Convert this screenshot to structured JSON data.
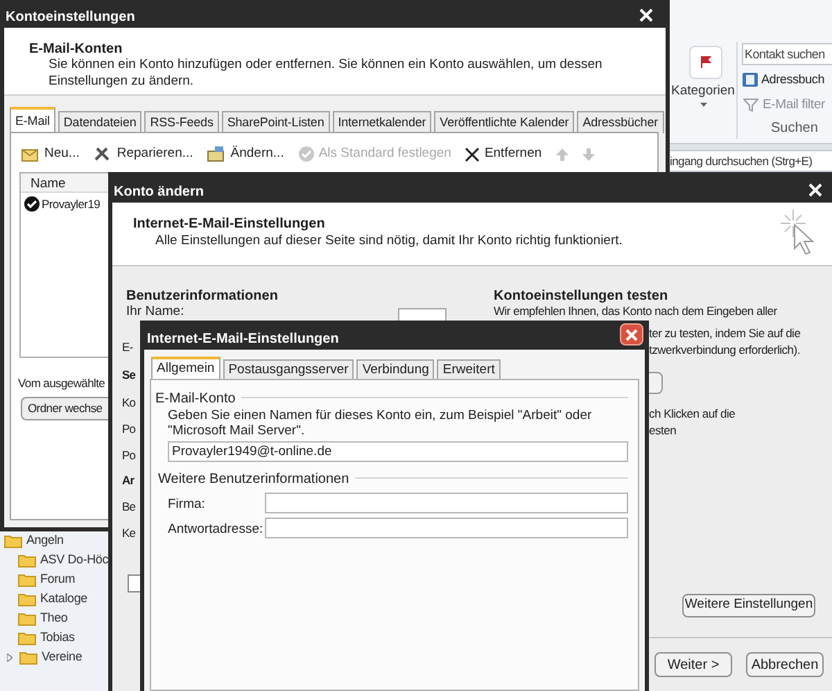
{
  "outlook": {
    "ribbon": {
      "categories_label": "Kategorien",
      "contact_search": {
        "placeholder": "Kontakt suchen"
      },
      "address_book": "Adressbuch",
      "filter_email": {
        "label": "E-Mail filter",
        "disabled": true
      },
      "group_label": "Suchen"
    },
    "search": {
      "placeholder": "ingang durchsuchen (Strg+E)"
    },
    "folders": [
      {
        "name": "Angeln",
        "kind": "folder",
        "children": [
          {
            "name": "ASV Do-Höc",
            "kind": "folder"
          },
          {
            "name": "Forum",
            "kind": "folder"
          },
          {
            "name": "Kataloge",
            "kind": "folder"
          },
          {
            "name": "Theo",
            "kind": "folder"
          },
          {
            "name": "Tobias",
            "kind": "folder"
          },
          {
            "name": "Vereine",
            "kind": "collapsed-folder"
          }
        ]
      }
    ]
  },
  "account_settings": {
    "title": "Kontoeinstellungen",
    "heading": "E-Mail-Konten",
    "description": "Sie können ein Konto hinzufügen oder entfernen. Sie können ein Konto auswählen, um dessen Einstellungen zu ändern.",
    "tabs": [
      {
        "label": "E-Mail",
        "selected": true
      },
      {
        "label": "Datendateien",
        "selected": false
      },
      {
        "label": "RSS-Feeds",
        "selected": false
      },
      {
        "label": "SharePoint-Listen",
        "selected": false
      },
      {
        "label": "Internetkalender",
        "selected": false
      },
      {
        "label": "Veröffentlichte Kalender",
        "selected": false
      },
      {
        "label": "Adressbücher",
        "selected": false
      }
    ],
    "toolbar": [
      {
        "kind": "button",
        "label": "Neu...",
        "disabled": false
      },
      {
        "kind": "button",
        "label": "Reparieren...",
        "disabled": false
      },
      {
        "kind": "button",
        "label": "Ändern...",
        "disabled": false
      },
      {
        "kind": "button",
        "label": "Als Standard festlegen",
        "disabled": true
      },
      {
        "kind": "button",
        "label": "Entfernen",
        "disabled": false
      },
      {
        "kind": "arrow-up",
        "disabled": true
      },
      {
        "kind": "arrow-down",
        "disabled": true
      }
    ],
    "list": {
      "column": "Name",
      "rows": [
        {
          "name": "Provayler19",
          "default": true
        }
      ]
    },
    "footer_text": "Vom ausgewählte",
    "change_folder_button": "Ordner wechse"
  },
  "change_account": {
    "title": "Konto ändern",
    "heading": "Internet-E-Mail-Einstellungen",
    "description": "Alle Einstellungen auf dieser Seite sind nötig, damit Ihr Konto richtig funktioniert.",
    "user_info": {
      "heading": "Benutzerinformationen",
      "name_label": "Ihr Name:"
    },
    "left_fragments": [
      "E-",
      "Se",
      "Ko",
      "Po",
      "Po",
      "Ar",
      "Be",
      "Ke"
    ],
    "test": {
      "heading": "Kontoeinstellungen testen",
      "lines": [
        "Wir empfehlen Ihnen, das Konto nach dem Eingeben aller",
        "ter zu testen, indem Sie auf die",
        "tzwerkverbindung erforderlich).",
        "ch Klicken auf die",
        "esten"
      ]
    },
    "checkbox": {
      "checked": false
    },
    "more_settings_button": "Weitere Einstellungen",
    "buttons": [
      "Weiter >",
      "Abbrechen"
    ]
  },
  "internet_settings": {
    "title": "Internet-E-Mail-Einstellungen",
    "tabs": [
      {
        "label": "Allgemein",
        "selected": true
      },
      {
        "label": "Postausgangsserver",
        "selected": false
      },
      {
        "label": "Verbindung",
        "selected": false
      },
      {
        "label": "Erweitert",
        "selected": false
      }
    ],
    "account_group": {
      "legend": "E-Mail-Konto",
      "hint": "Geben Sie einen Namen für dieses Konto ein, zum Beispiel \"Arbeit\" oder \"Microsoft Mail Server\".",
      "value": "Provayler1949@t-online.de"
    },
    "more_group": {
      "legend": "Weitere Benutzerinformationen",
      "fields": [
        {
          "label": "Firma:"
        },
        {
          "label": "Antwortadresse:"
        }
      ]
    }
  }
}
